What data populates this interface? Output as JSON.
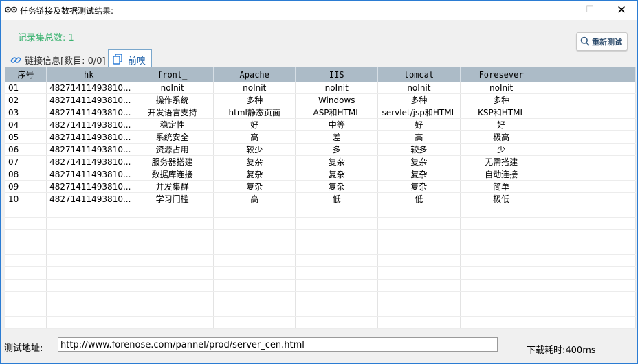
{
  "window": {
    "title": "任务链接及数据测试结果:",
    "icon": "glasses-icon",
    "controls": {
      "minimize": "—",
      "maximize": "☐",
      "close": "✕"
    }
  },
  "record_count": "记录集总数: 1",
  "retest_button": {
    "label": "重新测试",
    "icon": "search-icon"
  },
  "tabs": [
    {
      "label": "链接信息[数目: 0/0]",
      "icon": "link-icon",
      "active": false
    },
    {
      "label": "前嗅",
      "icon": "copy-icon",
      "active": true
    }
  ],
  "table": {
    "columns": [
      "序号",
      "hk",
      "front_",
      "Apache",
      "IIS",
      "tomcat",
      "Foresever",
      ""
    ],
    "rows": [
      [
        "01",
        "48271411493810...",
        "noInit",
        "noInit",
        "noInit",
        "noInit",
        "noInit"
      ],
      [
        "02",
        "48271411493810...",
        "操作系统",
        "多种",
        "Windows",
        "多种",
        "多种"
      ],
      [
        "03",
        "48271411493810...",
        "开发语言支持",
        "html静态页面",
        "ASP和HTML",
        "servlet/jsp和HTML",
        "KSP和HTML"
      ],
      [
        "04",
        "48271411493810...",
        "稳定性",
        "好",
        "中等",
        "好",
        "好"
      ],
      [
        "05",
        "48271411493810...",
        "系统安全",
        "高",
        "差",
        "高",
        "极高"
      ],
      [
        "06",
        "48271411493810...",
        "资源占用",
        "较少",
        "多",
        "较多",
        "少"
      ],
      [
        "07",
        "48271411493810...",
        "服务器搭建",
        "复杂",
        "复杂",
        "复杂",
        "无需搭建"
      ],
      [
        "08",
        "48271411493810...",
        "数据库连接",
        "复杂",
        "复杂",
        "复杂",
        "自动连接"
      ],
      [
        "09",
        "48271411493810...",
        "并发集群",
        "复杂",
        "复杂",
        "复杂",
        "简单"
      ],
      [
        "10",
        "48271411493810...",
        "学习门槛",
        "高",
        "低",
        "低",
        "极低"
      ]
    ]
  },
  "address": {
    "label": "测试地址:",
    "value": "http://www.forenose.com/pannel/prod/server_cen.html"
  },
  "timing": "下载耗时:400ms",
  "colors": {
    "header_bg": "#acbbc7",
    "count_text": "#3cb371",
    "tab_active_text": "#1a5ea8"
  }
}
